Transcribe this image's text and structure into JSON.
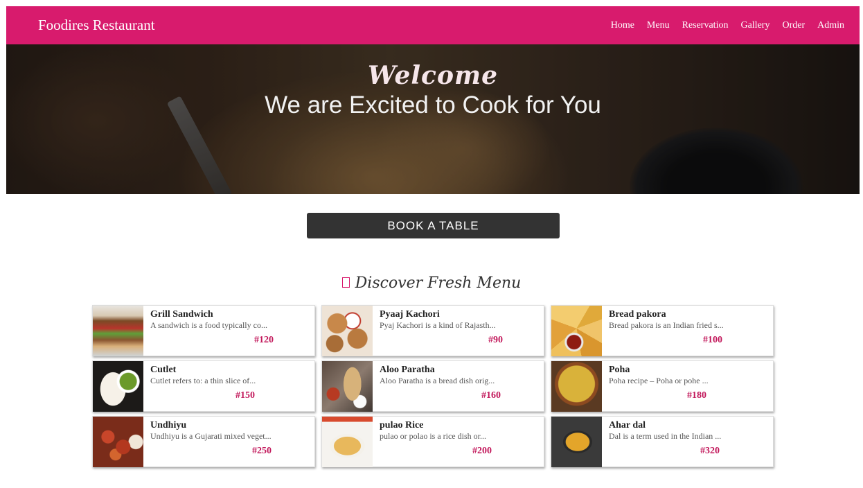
{
  "navbar": {
    "brand": "Foodires Restaurant",
    "links": [
      "Home",
      "Menu",
      "Reservation",
      "Gallery",
      "Order",
      "Admin"
    ]
  },
  "hero": {
    "welcome": "Welcome",
    "tagline": "We are Excited to Cook for You"
  },
  "book_button": "BOOK A TABLE",
  "section_title": "Discover Fresh Menu",
  "menu_items": [
    {
      "name": "Grill Sandwich",
      "desc": "A sandwich is a food typically co...",
      "price": "#120"
    },
    {
      "name": "Pyaaj Kachori",
      "desc": "Pyaj Kachori is a kind of Rajasth...",
      "price": "#90"
    },
    {
      "name": "Bread pakora",
      "desc": "Bread pakora is an Indian fried s...",
      "price": "#100"
    },
    {
      "name": "Cutlet",
      "desc": "Cutlet refers to: a thin slice of...",
      "price": "#150"
    },
    {
      "name": "Aloo Paratha",
      "desc": "Aloo Paratha is a bread dish orig...",
      "price": "#160"
    },
    {
      "name": "Poha",
      "desc": "Poha recipe – Poha or pohe ...",
      "price": "#180"
    },
    {
      "name": "Undhiyu",
      "desc": "Undhiyu is a Gujarati mixed veget...",
      "price": "#250"
    },
    {
      "name": "pulao Rice",
      "desc": "pulao or polao is a rice dish or...",
      "price": "#200"
    },
    {
      "name": "Ahar dal",
      "desc": "Dal is a term used in the Indian ...",
      "price": "#320"
    }
  ],
  "colors": {
    "brand": "#d81b6d",
    "price": "#c2185b",
    "button": "#333333"
  }
}
